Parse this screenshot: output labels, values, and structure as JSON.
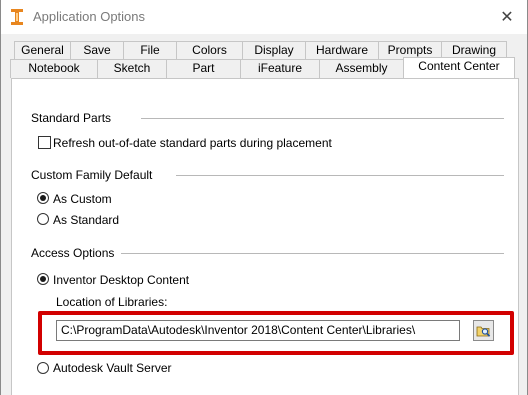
{
  "window": {
    "title": "Application Options",
    "close_glyph": "✕"
  },
  "tabs": {
    "row1": [
      "General",
      "Save",
      "File",
      "Colors",
      "Display",
      "Hardware",
      "Prompts",
      "Drawing"
    ],
    "row2": [
      "Notebook",
      "Sketch",
      "Part",
      "iFeature",
      "Assembly",
      "Content Center"
    ],
    "active": "Content Center"
  },
  "standard_parts": {
    "label": "Standard Parts",
    "refresh_checkbox": {
      "label": "Refresh out-of-date standard parts during placement",
      "checked": false
    }
  },
  "custom_family_default": {
    "label": "Custom Family Default",
    "options": [
      {
        "label": "As Custom",
        "checked": true
      },
      {
        "label": "As Standard",
        "checked": false
      }
    ]
  },
  "access_options": {
    "label": "Access Options",
    "desktop_content": {
      "label": "Inventor Desktop Content",
      "checked": true
    },
    "location_label": "Location of Libraries:",
    "location_value": "C:\\ProgramData\\Autodesk\\Inventor 2018\\Content Center\\Libraries\\",
    "vault_server": {
      "label": "Autodesk Vault Server",
      "checked": false
    }
  },
  "colors": {
    "highlight": "#d20000",
    "title_text": "#7a7a7a"
  },
  "icons": {
    "app": "inventor-app-icon",
    "browse": "browse-folder-icon",
    "close": "close-icon"
  }
}
